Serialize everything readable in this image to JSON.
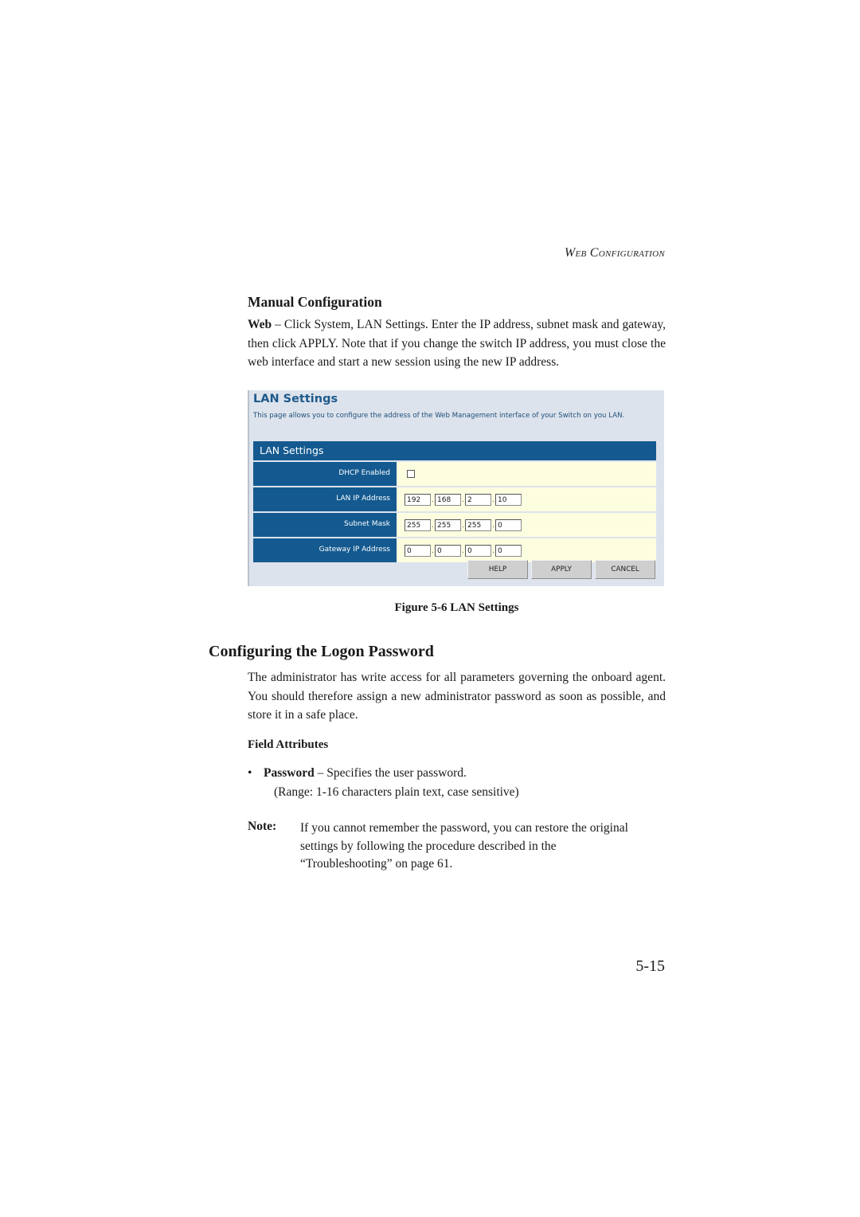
{
  "running_head": "Web Configuration",
  "manual_config": {
    "heading": "Manual Configuration",
    "lead_bold": "Web",
    "text": " – Click System, LAN Settings. Enter the IP address, subnet mask and gateway, then click APPLY. Note that if you change the switch IP address, you must close the web interface and start a new session using the new IP address."
  },
  "screenshot": {
    "title": "LAN Settings",
    "description": "This page allows you to configure the address of the Web Management interface of your Switch on you LAN.",
    "table_header": "LAN Settings",
    "rows": [
      {
        "label": "DHCP Enabled",
        "type": "checkbox",
        "checked": false
      },
      {
        "label": "LAN IP Address",
        "type": "ip",
        "octets": [
          "192",
          "168",
          "2",
          "10"
        ]
      },
      {
        "label": "Subnet Mask",
        "type": "ip",
        "octets": [
          "255",
          "255",
          "255",
          "0"
        ]
      },
      {
        "label": "Gateway IP Address",
        "type": "ip",
        "octets": [
          "0",
          "0",
          "0",
          "0"
        ]
      }
    ],
    "buttons": {
      "help": "HELP",
      "apply": "APPLY",
      "cancel": "CANCEL"
    },
    "colors": {
      "header_blue": "#145a90",
      "value_bg": "#fdfde0",
      "panel_bg": "#dde3ec"
    }
  },
  "figure_caption": "Figure 5-6  LAN Settings",
  "logon_password": {
    "heading": "Configuring the Logon Password",
    "text": "The administrator has write access for all parameters governing the onboard agent. You should therefore assign a new administrator password as soon as possible, and store it in a safe place.",
    "field_attributes_heading": "Field Attributes",
    "bullet_bold": "Password",
    "bullet_text": " – Specifies the user password.",
    "range": "(Range: 1-16 characters plain text, case sensitive)",
    "note_label": "Note:",
    "note_text": "If you cannot remember the password, you can restore the original settings by following the procedure described in the “Troubleshooting” on page 61."
  },
  "page_number": "5-15"
}
